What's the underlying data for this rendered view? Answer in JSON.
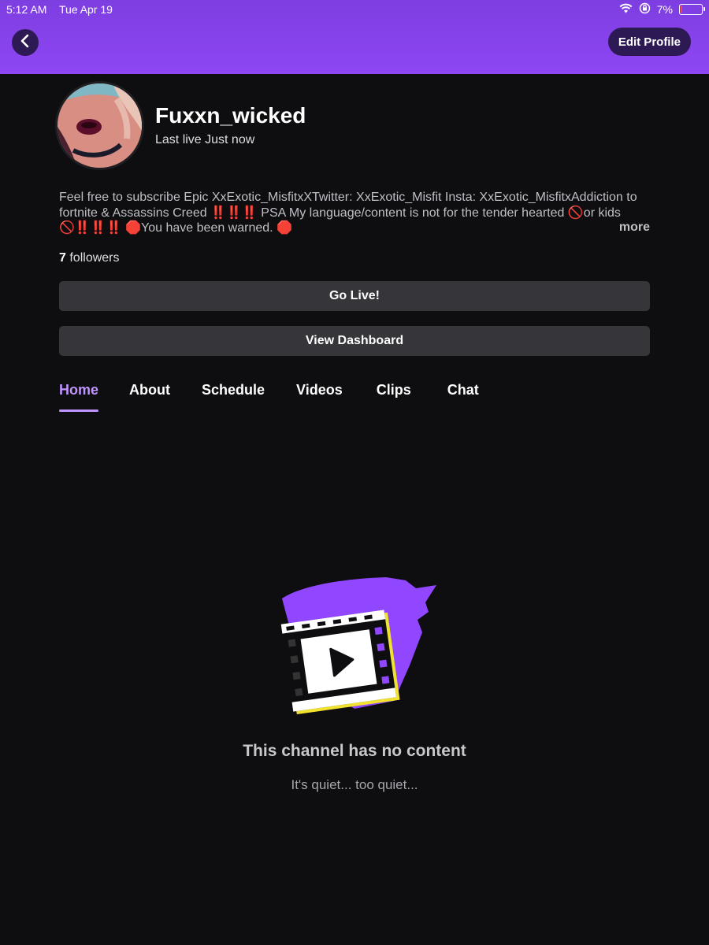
{
  "status_bar": {
    "time": "5:12 AM",
    "date": "Tue Apr 19",
    "battery": "7%",
    "battery_level": 0.07
  },
  "header": {
    "back_icon": "chevron-left-icon",
    "edit_profile_label": "Edit Profile"
  },
  "profile": {
    "channel_name": "Fuxxn_wicked",
    "last_live": "Last live Just now",
    "bio": "Feel free to subscribe Epic XxExotic_MisfitxXTwitter: XxExotic_Misfit Insta: XxExotic_MisfitxAddiction to fortnite & Assassins Creed ‼️‼️‼️ PSA My language/content  is not for the tender hearted 🚫or kids🚫‼️‼️‼️ 🛑You have been warned. 🛑",
    "more_label": "more",
    "followers_count": "7",
    "followers_label": "followers"
  },
  "actions": {
    "go_live_label": "Go Live!",
    "dashboard_label": "View Dashboard"
  },
  "tabs": [
    {
      "label": "Home",
      "active": true
    },
    {
      "label": "About",
      "active": false
    },
    {
      "label": "Schedule",
      "active": false
    },
    {
      "label": "Videos",
      "active": false
    },
    {
      "label": "Clips",
      "active": false
    },
    {
      "label": "Chat",
      "active": false
    }
  ],
  "empty_state": {
    "icon": "film-play-icon",
    "title": "This channel has no content",
    "subtitle": "It's quiet... too quiet..."
  },
  "colors": {
    "accent": "#9147ff",
    "accent_light": "#bf94ff",
    "background": "#0e0e10",
    "button_bg": "#35353a",
    "highlight_yellow": "#f2e230"
  }
}
